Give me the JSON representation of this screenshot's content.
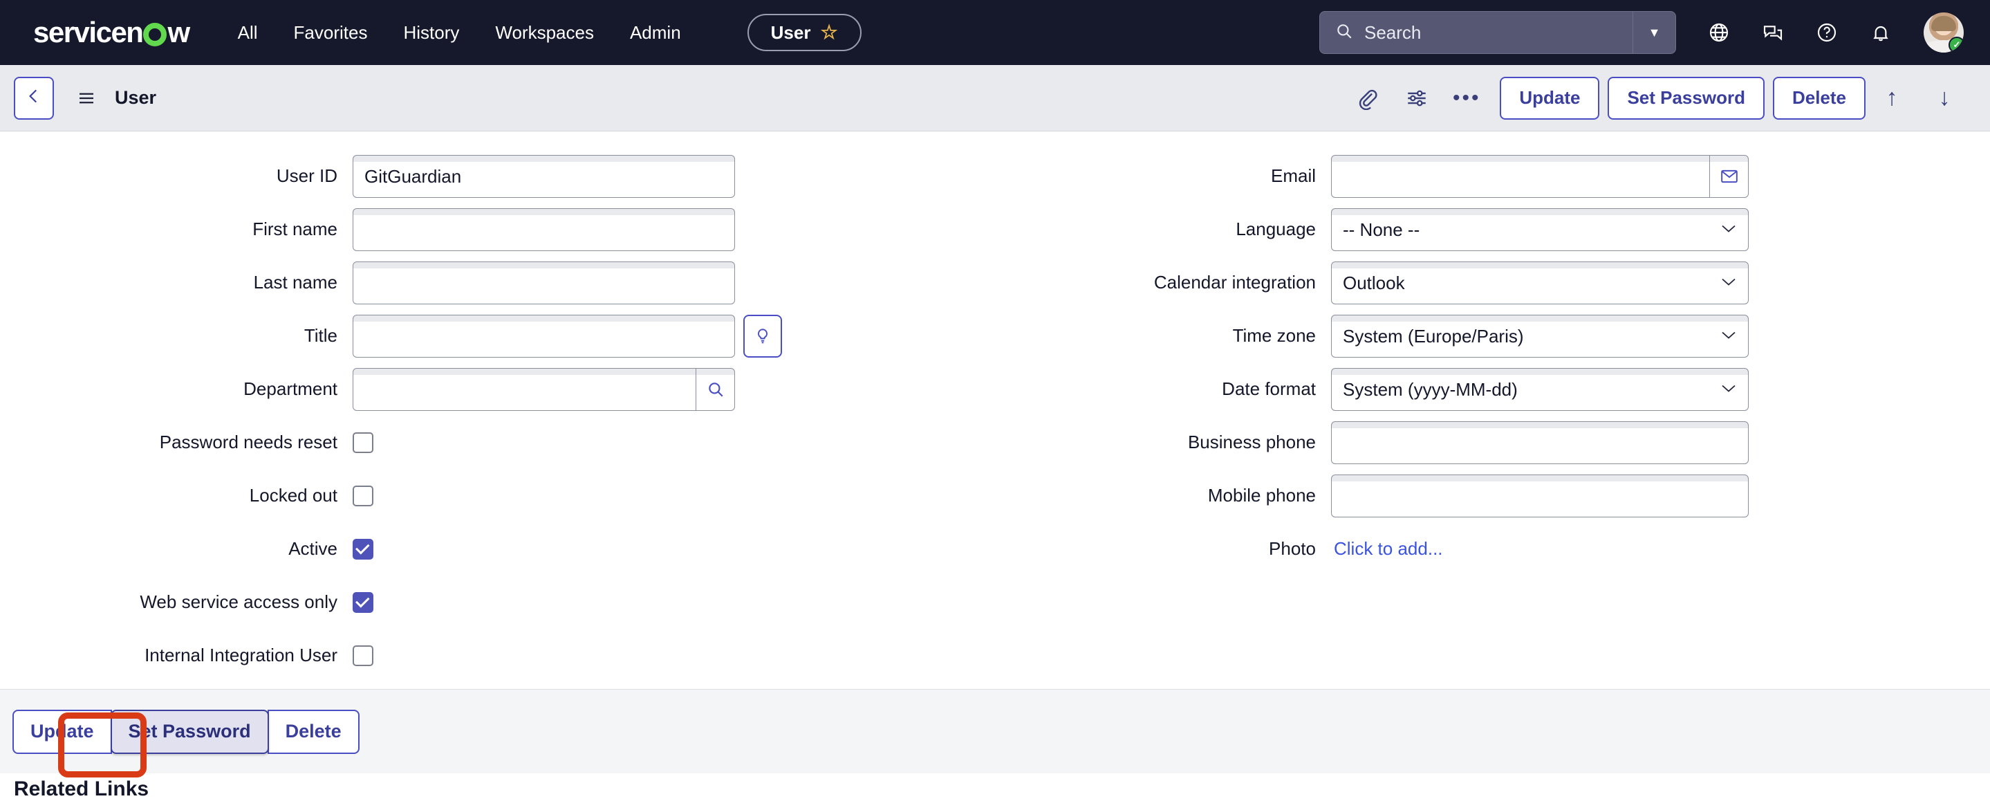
{
  "topnav": {
    "logo_pre": "servicen",
    "logo_post": "w",
    "links": [
      "All",
      "Favorites",
      "History",
      "Workspaces",
      "Admin"
    ],
    "user_pill": {
      "label": "User",
      "icon": "star-icon",
      "star": "☆"
    },
    "search": {
      "placeholder": "Search",
      "icon": "search-icon",
      "dropdown_icon": "▼"
    },
    "icons": [
      "globe-icon",
      "chat-icon",
      "help-icon",
      "bell-icon",
      "avatar"
    ],
    "avatar_badge": "✓",
    "background": "#16182b",
    "accent_green": "#62d84e",
    "star_color": "#e8b54d"
  },
  "formbar": {
    "back_icon": "chevron-left-icon",
    "menu_icon": "hamburger-icon",
    "title": "User",
    "icons": [
      "attachment-icon",
      "personalize-icon",
      "more-options-icon"
    ],
    "dots": "•••",
    "buttons": [
      "Update",
      "Set Password",
      "Delete"
    ],
    "nav_up": "↑",
    "nav_down": "↓",
    "accent": "#4a4ec4",
    "background": "#e8eaee"
  },
  "form": {
    "left": [
      {
        "label": "User ID",
        "type": "text",
        "value": "GitGuardian",
        "addon": null
      },
      {
        "label": "First name",
        "type": "text",
        "value": "",
        "addon": null
      },
      {
        "label": "Last name",
        "type": "text",
        "value": "",
        "addon": null
      },
      {
        "label": "Title",
        "type": "text",
        "value": "",
        "addon": "suggestion-icon"
      },
      {
        "label": "Department",
        "type": "lookup",
        "value": "",
        "addon": "search-icon"
      },
      {
        "label": "Password needs reset",
        "type": "checkbox",
        "value": "",
        "checked": false
      },
      {
        "label": "Locked out",
        "type": "checkbox",
        "value": "",
        "checked": false
      },
      {
        "label": "Active",
        "type": "checkbox",
        "value": "",
        "checked": true
      },
      {
        "label": "Web service access only",
        "type": "checkbox",
        "value": "",
        "checked": true
      },
      {
        "label": "Internal Integration User",
        "type": "checkbox",
        "value": "",
        "checked": false
      }
    ],
    "right": [
      {
        "label": "Email",
        "type": "text",
        "value": "",
        "addon": "envelope-icon"
      },
      {
        "label": "Language",
        "type": "select",
        "value": "-- None --",
        "addon": null
      },
      {
        "label": "Calendar integration",
        "type": "select",
        "value": "Outlook",
        "addon": null
      },
      {
        "label": "Time zone",
        "type": "select",
        "value": "System (Europe/Paris)",
        "addon": null
      },
      {
        "label": "Date format",
        "type": "select",
        "value": "System (yyyy-MM-dd)",
        "addon": null
      },
      {
        "label": "Business phone",
        "type": "text",
        "value": "",
        "addon": null
      },
      {
        "label": "Mobile phone",
        "type": "text",
        "value": "",
        "addon": null
      },
      {
        "label": "Photo",
        "type": "link",
        "value": "Click to add...",
        "addon": null
      }
    ],
    "checkbox_color": "#4f52b8",
    "link_color": "#3a53e0"
  },
  "bottombar": {
    "buttons": [
      "Update",
      "Set Password",
      "Delete"
    ],
    "active_index": 1,
    "background": "#f4f5f7"
  },
  "highlight": {
    "target": "Set Password",
    "color": "#d83b16"
  },
  "related_links_heading": "Related Links"
}
